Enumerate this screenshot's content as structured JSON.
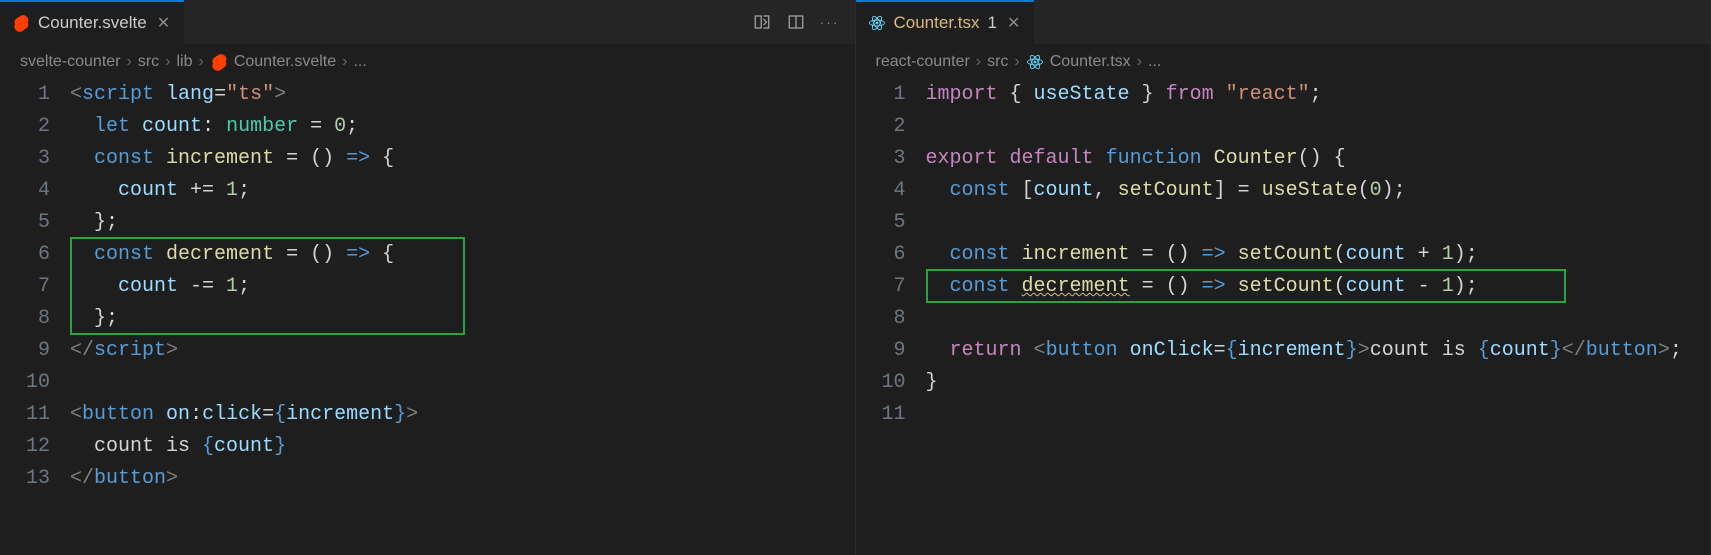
{
  "left": {
    "tab": {
      "label": "Counter.svelte"
    },
    "breadcrumb": [
      "svelte-counter",
      "src",
      "lib",
      "Counter.svelte",
      "..."
    ],
    "lines": 13,
    "highlight_lines": [
      6,
      8
    ],
    "code_lines": {
      "1": [
        [
          "gy",
          "<"
        ],
        [
          "bl",
          "script"
        ],
        [
          "wh",
          " "
        ],
        [
          "lb",
          "lang"
        ],
        [
          "wh",
          "="
        ],
        [
          "st",
          "\"ts\""
        ],
        [
          "gy",
          ">"
        ]
      ],
      "2": [
        [
          "wh",
          "  "
        ],
        [
          "bl",
          "let"
        ],
        [
          "wh",
          " "
        ],
        [
          "lb",
          "count"
        ],
        [
          "wh",
          ": "
        ],
        [
          "gr",
          "number"
        ],
        [
          "wh",
          " = "
        ],
        [
          "nm",
          "0"
        ],
        [
          "wh",
          ";"
        ]
      ],
      "3": [
        [
          "wh",
          "  "
        ],
        [
          "bl",
          "const"
        ],
        [
          "wh",
          " "
        ],
        [
          "fn",
          "increment"
        ],
        [
          "wh",
          " = () "
        ],
        [
          "bl",
          "=>"
        ],
        [
          "wh",
          " {"
        ]
      ],
      "4": [
        [
          "wh",
          "    "
        ],
        [
          "lb",
          "count"
        ],
        [
          "wh",
          " += "
        ],
        [
          "nm",
          "1"
        ],
        [
          "wh",
          ";"
        ]
      ],
      "5": [
        [
          "wh",
          "  };"
        ]
      ],
      "6": [
        [
          "wh",
          "  "
        ],
        [
          "bl",
          "const"
        ],
        [
          "wh",
          " "
        ],
        [
          "fn",
          "decrement"
        ],
        [
          "wh",
          " = () "
        ],
        [
          "bl",
          "=>"
        ],
        [
          "wh",
          " {"
        ]
      ],
      "7": [
        [
          "wh",
          "    "
        ],
        [
          "lb",
          "count"
        ],
        [
          "wh",
          " -= "
        ],
        [
          "nm",
          "1"
        ],
        [
          "wh",
          ";"
        ]
      ],
      "8": [
        [
          "wh",
          "  };"
        ]
      ],
      "9": [
        [
          "gy",
          "</"
        ],
        [
          "bl",
          "script"
        ],
        [
          "gy",
          ">"
        ]
      ],
      "10": [],
      "11": [
        [
          "gy",
          "<"
        ],
        [
          "bl",
          "button"
        ],
        [
          "wh",
          " "
        ],
        [
          "lb",
          "on"
        ],
        [
          "wh",
          ":"
        ],
        [
          "lb",
          "click"
        ],
        [
          "wh",
          "="
        ],
        [
          "bl",
          "{"
        ],
        [
          "lb",
          "increment"
        ],
        [
          "bl",
          "}"
        ],
        [
          "gy",
          ">"
        ]
      ],
      "12": [
        [
          "wh",
          "  count is "
        ],
        [
          "bl",
          "{"
        ],
        [
          "lb",
          "count"
        ],
        [
          "bl",
          "}"
        ]
      ],
      "13": [
        [
          "gy",
          "</"
        ],
        [
          "bl",
          "button"
        ],
        [
          "gy",
          ">"
        ]
      ]
    }
  },
  "right": {
    "tab": {
      "label": "Counter.tsx",
      "modified": "1"
    },
    "breadcrumb": [
      "react-counter",
      "src",
      "Counter.tsx",
      "..."
    ],
    "lines": 11,
    "highlight_lines": [
      7,
      7
    ],
    "code_lines": {
      "1": [
        [
          "kw",
          "import"
        ],
        [
          "wh",
          " { "
        ],
        [
          "lb",
          "useState"
        ],
        [
          "wh",
          " } "
        ],
        [
          "kw",
          "from"
        ],
        [
          "wh",
          " "
        ],
        [
          "st",
          "\"react\""
        ],
        [
          "wh",
          ";"
        ]
      ],
      "2": [],
      "3": [
        [
          "kw",
          "export"
        ],
        [
          "wh",
          " "
        ],
        [
          "kw",
          "default"
        ],
        [
          "wh",
          " "
        ],
        [
          "bl",
          "function"
        ],
        [
          "wh",
          " "
        ],
        [
          "fn",
          "Counter"
        ],
        [
          "wh",
          "() {"
        ]
      ],
      "4": [
        [
          "wh",
          "  "
        ],
        [
          "bl",
          "const"
        ],
        [
          "wh",
          " ["
        ],
        [
          "lb",
          "count"
        ],
        [
          "wh",
          ", "
        ],
        [
          "fn",
          "setCount"
        ],
        [
          "wh",
          "] = "
        ],
        [
          "fn",
          "useState"
        ],
        [
          "wh",
          "("
        ],
        [
          "nm",
          "0"
        ],
        [
          "wh",
          ");"
        ]
      ],
      "5": [],
      "6": [
        [
          "wh",
          "  "
        ],
        [
          "bl",
          "const"
        ],
        [
          "wh",
          " "
        ],
        [
          "fn",
          "increment"
        ],
        [
          "wh",
          " = () "
        ],
        [
          "bl",
          "=>"
        ],
        [
          "wh",
          " "
        ],
        [
          "fn",
          "setCount"
        ],
        [
          "wh",
          "("
        ],
        [
          "lb",
          "count"
        ],
        [
          "wh",
          " + "
        ],
        [
          "nm",
          "1"
        ],
        [
          "wh",
          ");"
        ]
      ],
      "7": [
        [
          "wh",
          "  "
        ],
        [
          "bl",
          "const"
        ],
        [
          "wh",
          " "
        ],
        [
          "fn",
          "decrement",
          true
        ],
        [
          "wh",
          " = () "
        ],
        [
          "bl",
          "=>"
        ],
        [
          "wh",
          " "
        ],
        [
          "fn",
          "setCount"
        ],
        [
          "wh",
          "("
        ],
        [
          "lb",
          "count"
        ],
        [
          "wh",
          " - "
        ],
        [
          "nm",
          "1"
        ],
        [
          "wh",
          ");"
        ]
      ],
      "8": [],
      "9": [
        [
          "wh",
          "  "
        ],
        [
          "kw",
          "return"
        ],
        [
          "wh",
          " "
        ],
        [
          "gy",
          "<"
        ],
        [
          "bl",
          "button"
        ],
        [
          "wh",
          " "
        ],
        [
          "lb",
          "onClick"
        ],
        [
          "wh",
          "="
        ],
        [
          "bl",
          "{"
        ],
        [
          "lb",
          "increment"
        ],
        [
          "bl",
          "}"
        ],
        [
          "gy",
          ">"
        ],
        [
          "wh",
          "count is "
        ],
        [
          "bl",
          "{"
        ],
        [
          "lb",
          "count"
        ],
        [
          "bl",
          "}"
        ],
        [
          "gy",
          "</"
        ],
        [
          "bl",
          "button"
        ],
        [
          "gy",
          ">"
        ],
        [
          "wh",
          ";"
        ]
      ],
      "10": [
        [
          "wh",
          "}"
        ]
      ],
      "11": []
    }
  },
  "colors": {
    "highlight_border": "#2ea043"
  }
}
